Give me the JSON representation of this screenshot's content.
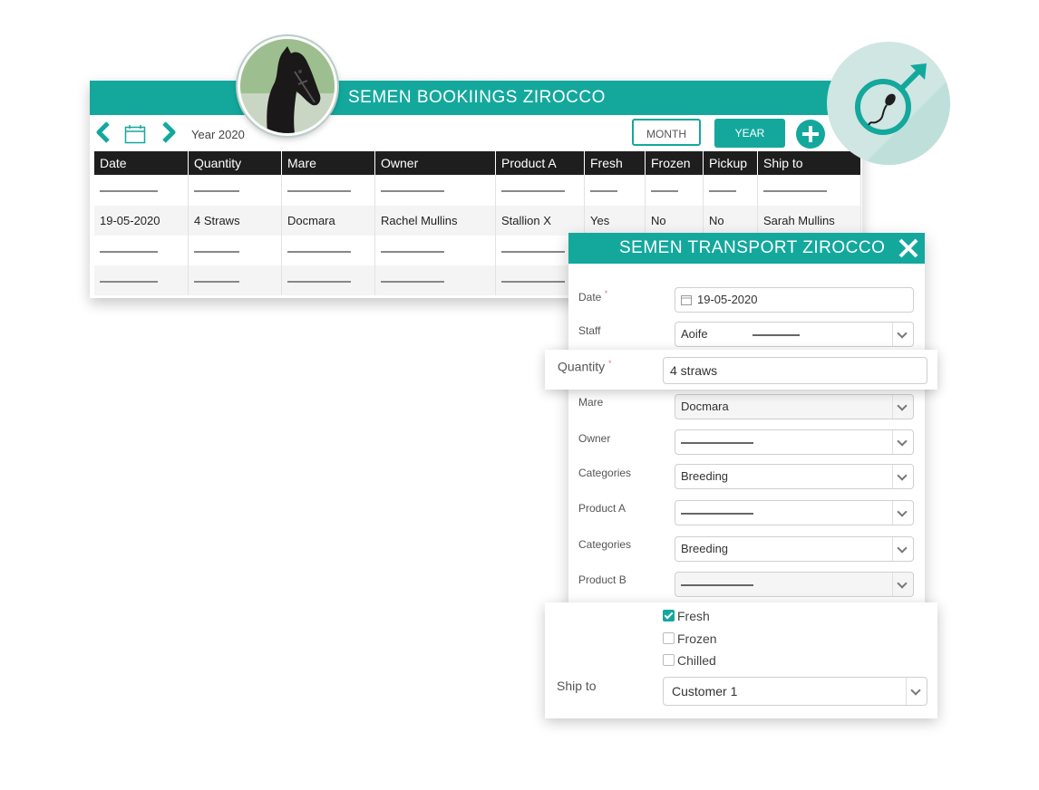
{
  "bookings": {
    "title": "SEMEN BOOKIINGS ZIROCCO",
    "year_label": "Year 2020",
    "month_label": "MONTH",
    "year_label_btn": "YEAR",
    "columns": [
      "Date",
      "Quantity",
      "Mare",
      "Owner",
      "Product A",
      "Fresh",
      "Frozen",
      "Pickup",
      "Ship to"
    ],
    "row": {
      "date": "19-05-2020",
      "quantity": "4 Straws",
      "mare": "Docmara",
      "owner": "Rachel Mullins",
      "product_a": "Stallion X",
      "fresh": "Yes",
      "frozen": "No",
      "pickup": "No",
      "ship_to": "Sarah Mullins"
    }
  },
  "transport": {
    "title": "SEMEN TRANSPORT ZIROCCO",
    "required_mark": "*",
    "date_label": "Date",
    "date_value": "19-05-2020",
    "staff_label": "Staff",
    "staff_value": "Aoife",
    "quantity_label": "Quantity",
    "quantity_value": "4 straws",
    "mare_label": "Mare",
    "mare_value": "Docmara",
    "owner_label": "Owner",
    "categories_label_1": "Categories",
    "categories_value_1": "Breeding",
    "product_a_label": "Product A",
    "categories_label_2": "Categories",
    "categories_value_2": "Breeding",
    "product_b_label": "Product B",
    "fresh_label": "Fresh",
    "frozen_label": "Frozen",
    "chilled_label": "Chilled",
    "fresh_checked": true,
    "frozen_checked": false,
    "chilled_checked": false,
    "ship_to_label": "Ship to",
    "ship_to_value": "Customer 1"
  },
  "colors": {
    "accent": "#14a89d",
    "header_dark": "#1e1e1e",
    "badge_bg": "#cfe6e2"
  },
  "icons": [
    "chevron-left-icon",
    "calendar-icon",
    "chevron-right-icon",
    "plus-icon",
    "close-icon",
    "male-symbol-icon",
    "sperm-icon",
    "chevron-down-icon",
    "checkbox-icon"
  ]
}
